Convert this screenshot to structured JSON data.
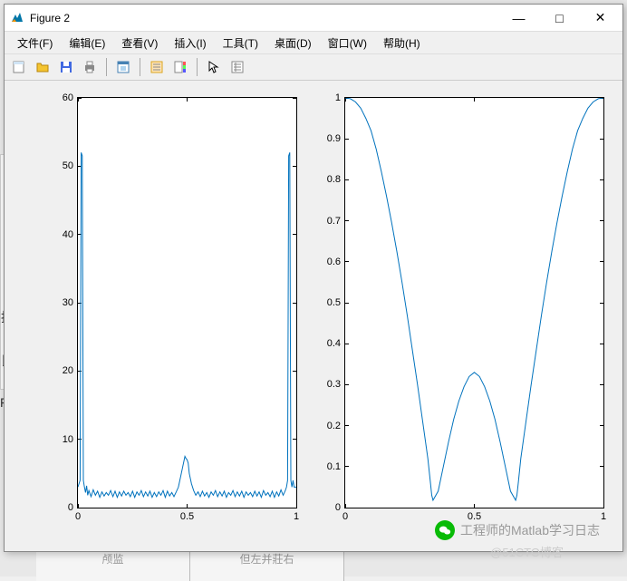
{
  "window": {
    "title": "Figure 2",
    "min_label": "—",
    "max_label": "□",
    "close_label": "✕"
  },
  "menu": {
    "file": "文件(F)",
    "edit": "编辑(E)",
    "view": "查看(V)",
    "insert": "插入(I)",
    "tools": "工具(T)",
    "desktop": "桌面(D)",
    "window": "窗口(W)",
    "help": "帮助(H)"
  },
  "toolbar_icons": {
    "new": "new-figure-icon",
    "open": "open-icon",
    "save": "save-icon",
    "print": "print-icon",
    "edit_plot": "edit-plot-icon",
    "link": "link-icon",
    "colorbar": "colorbar-icon",
    "legend": "legend-icon",
    "pointer": "pointer-icon",
    "properties": "properties-icon"
  },
  "watermark": {
    "text1": "工程师的Matlab学习日志",
    "text2": "@51CTO博客"
  },
  "background": {
    "text_bai": "拍",
    "text_si": "艮",
    "text_f0": "F(",
    "panel1": "颅监",
    "panel2": "但左并莊右"
  },
  "chart_data": [
    {
      "type": "line",
      "subplot": "left",
      "xlim": [
        0,
        1
      ],
      "ylim": [
        0,
        60
      ],
      "xticks": [
        0,
        0.5,
        1
      ],
      "yticks": [
        0,
        10,
        20,
        30,
        40,
        50,
        60
      ],
      "x": [
        0,
        0.01,
        0.015,
        0.02,
        0.025,
        0.03,
        0.035,
        0.04,
        0.045,
        0.05,
        0.06,
        0.07,
        0.08,
        0.09,
        0.1,
        0.11,
        0.12,
        0.13,
        0.14,
        0.15,
        0.16,
        0.17,
        0.18,
        0.19,
        0.2,
        0.21,
        0.22,
        0.23,
        0.24,
        0.25,
        0.26,
        0.27,
        0.28,
        0.29,
        0.3,
        0.31,
        0.32,
        0.33,
        0.34,
        0.35,
        0.36,
        0.37,
        0.38,
        0.39,
        0.4,
        0.41,
        0.42,
        0.43,
        0.44,
        0.45,
        0.46,
        0.47,
        0.48,
        0.49,
        0.495,
        0.5,
        0.505,
        0.51,
        0.52,
        0.53,
        0.54,
        0.55,
        0.56,
        0.57,
        0.58,
        0.59,
        0.6,
        0.61,
        0.62,
        0.63,
        0.64,
        0.65,
        0.66,
        0.67,
        0.68,
        0.69,
        0.7,
        0.71,
        0.72,
        0.73,
        0.74,
        0.75,
        0.76,
        0.77,
        0.78,
        0.79,
        0.8,
        0.81,
        0.82,
        0.83,
        0.84,
        0.85,
        0.86,
        0.87,
        0.88,
        0.89,
        0.9,
        0.91,
        0.92,
        0.93,
        0.94,
        0.95,
        0.955,
        0.96,
        0.965,
        0.97,
        0.975,
        0.98,
        0.985,
        0.99,
        1
      ],
      "y": [
        3,
        4,
        52,
        51.5,
        4,
        3,
        2.2,
        3.2,
        1.8,
        2.5,
        1.6,
        2.6,
        1.8,
        2.4,
        1.5,
        2.3,
        1.7,
        2.2,
        1.8,
        2.5,
        1.6,
        2.4,
        1.5,
        2.3,
        1.7,
        2.4,
        1.8,
        2.2,
        1.6,
        2.4,
        1.5,
        2.3,
        1.8,
        2.5,
        1.6,
        2.3,
        1.7,
        2.4,
        1.5,
        2.2,
        1.6,
        2.3,
        1.8,
        2.5,
        1.5,
        2.4,
        1.7,
        2.2,
        1.6,
        2.3,
        3,
        4.5,
        6,
        7.5,
        7.2,
        7,
        6.5,
        5,
        3.5,
        2.5,
        1.8,
        2.3,
        1.6,
        2.4,
        1.7,
        2.2,
        1.5,
        2.3,
        1.8,
        2.5,
        1.6,
        2.3,
        1.7,
        2.4,
        1.5,
        2.2,
        1.8,
        2.5,
        1.6,
        2.3,
        1.7,
        2.4,
        1.5,
        2.3,
        1.8,
        2.2,
        1.6,
        2.4,
        1.7,
        2.3,
        1.5,
        2.5,
        1.8,
        2.2,
        1.6,
        2.4,
        1.5,
        2.3,
        1.7,
        2.6,
        1.8,
        2.5,
        3,
        4,
        51.5,
        52,
        4,
        3,
        4,
        3,
        3
      ]
    },
    {
      "type": "line",
      "subplot": "right",
      "xlim": [
        0,
        1
      ],
      "ylim": [
        0,
        1
      ],
      "xticks": [
        0,
        0.5,
        1
      ],
      "yticks": [
        0,
        0.1,
        0.2,
        0.3,
        0.4,
        0.5,
        0.6,
        0.7,
        0.8,
        0.9,
        1
      ],
      "x": [
        0,
        0.02,
        0.04,
        0.06,
        0.08,
        0.1,
        0.12,
        0.14,
        0.16,
        0.18,
        0.2,
        0.22,
        0.24,
        0.26,
        0.28,
        0.3,
        0.32,
        0.33,
        0.335,
        0.34,
        0.36,
        0.38,
        0.4,
        0.42,
        0.44,
        0.46,
        0.48,
        0.5,
        0.52,
        0.54,
        0.56,
        0.58,
        0.6,
        0.62,
        0.64,
        0.66,
        0.665,
        0.67,
        0.68,
        0.7,
        0.72,
        0.74,
        0.76,
        0.78,
        0.8,
        0.82,
        0.84,
        0.86,
        0.88,
        0.9,
        0.92,
        0.94,
        0.96,
        0.98,
        1
      ],
      "y": [
        1,
        0.998,
        0.99,
        0.975,
        0.95,
        0.92,
        0.875,
        0.82,
        0.76,
        0.695,
        0.625,
        0.55,
        0.47,
        0.385,
        0.3,
        0.21,
        0.12,
        0.06,
        0.03,
        0.018,
        0.04,
        0.1,
        0.16,
        0.215,
        0.26,
        0.295,
        0.32,
        0.33,
        0.32,
        0.295,
        0.26,
        0.215,
        0.16,
        0.1,
        0.04,
        0.018,
        0.03,
        0.06,
        0.12,
        0.21,
        0.3,
        0.385,
        0.47,
        0.55,
        0.625,
        0.695,
        0.76,
        0.82,
        0.875,
        0.92,
        0.95,
        0.975,
        0.99,
        0.998,
        1
      ]
    }
  ]
}
